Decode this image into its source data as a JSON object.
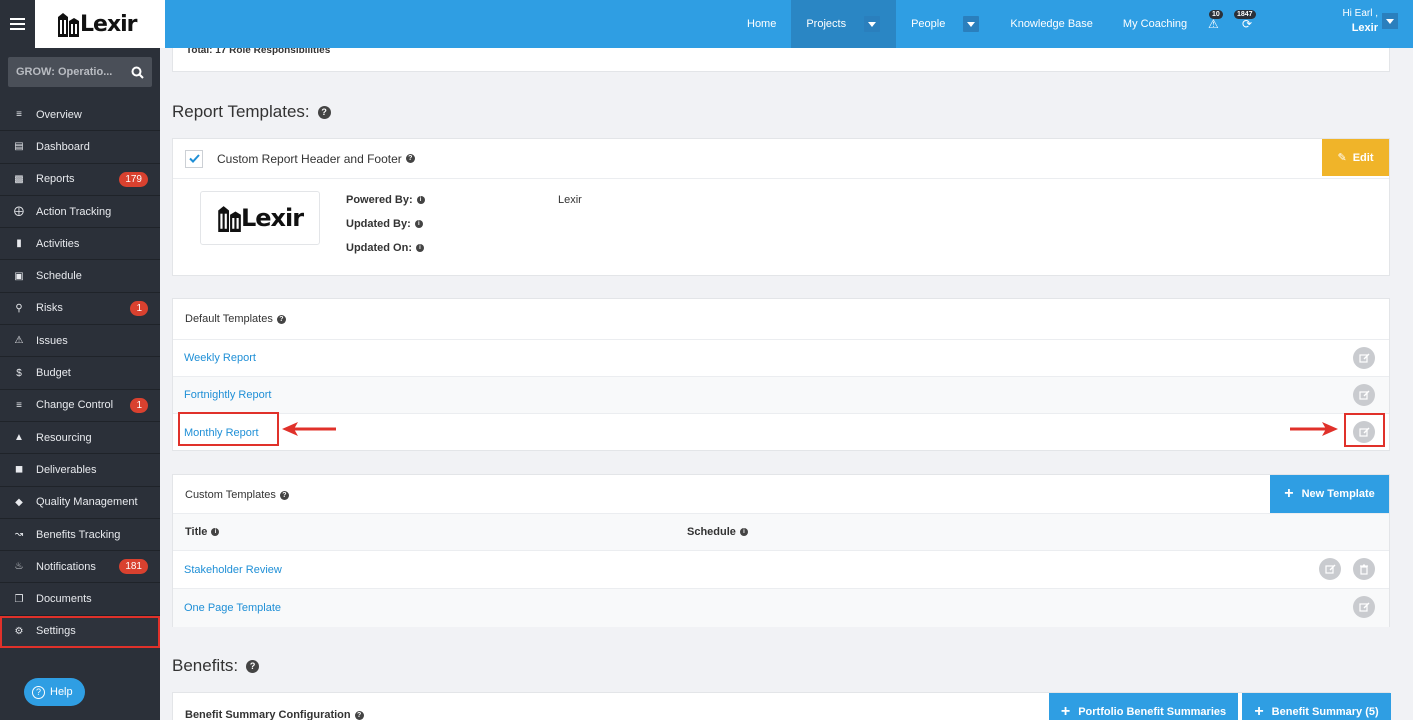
{
  "topbar": {
    "logo_text": "Lexir",
    "nav": [
      {
        "label": "Home"
      },
      {
        "label": "Projects"
      },
      {
        "label": "People"
      },
      {
        "label": "Knowledge Base"
      },
      {
        "label": "My Coaching"
      }
    ],
    "alerts_count": "10",
    "notifications_count": "1847",
    "greeting": "Hi Earl ,",
    "user_name": "Lexir"
  },
  "sidebar": {
    "search_value": "GROW: Operatio...",
    "items": [
      {
        "label": "Overview",
        "icon": "list-icon"
      },
      {
        "label": "Dashboard",
        "icon": "dashboard-icon"
      },
      {
        "label": "Reports",
        "icon": "bar-chart-icon",
        "badge": "179"
      },
      {
        "label": "Action Tracking",
        "icon": "crosshair-icon"
      },
      {
        "label": "Activities",
        "icon": "bookmark-icon"
      },
      {
        "label": "Schedule",
        "icon": "calendar-icon"
      },
      {
        "label": "Risks",
        "icon": "lightbulb-icon",
        "badge": "1"
      },
      {
        "label": "Issues",
        "icon": "warning-icon"
      },
      {
        "label": "Budget",
        "icon": "dollar-icon"
      },
      {
        "label": "Change Control",
        "icon": "stack-icon",
        "badge": "1"
      },
      {
        "label": "Resourcing",
        "icon": "folder-icon"
      },
      {
        "label": "Deliverables",
        "icon": "truck-icon"
      },
      {
        "label": "Quality Management",
        "icon": "tag-icon"
      },
      {
        "label": "Benefits Tracking",
        "icon": "line-chart-icon"
      },
      {
        "label": "Notifications",
        "icon": "bell-icon",
        "badge": "181"
      },
      {
        "label": "Documents",
        "icon": "copy-icon"
      },
      {
        "label": "Settings",
        "icon": "gears-icon"
      }
    ],
    "help_label": "Help"
  },
  "main": {
    "role_total": "Total: 17 Role Responsibilities",
    "report_templates_title": "Report Templates:",
    "header_footer": {
      "label": "Custom Report Header and Footer",
      "edit_label": "Edit",
      "logo_text": "Lexir",
      "powered_by_label": "Powered By:",
      "powered_by_value": "Lexir",
      "updated_by_label": "Updated By:",
      "updated_on_label": "Updated On:"
    },
    "default_templates": {
      "title": "Default Templates",
      "rows": [
        {
          "label": "Weekly Report"
        },
        {
          "label": "Fortnightly Report"
        },
        {
          "label": "Monthly Report"
        }
      ]
    },
    "custom_templates": {
      "title": "Custom Templates",
      "new_label": "New Template",
      "col_title": "Title",
      "col_schedule": "Schedule",
      "rows": [
        {
          "label": "Stakeholder Review"
        },
        {
          "label": "One Page Template"
        }
      ]
    },
    "benefits_title": "Benefits:",
    "benefit_summary": {
      "label": "Benefit Summary Configuration",
      "portfolio_btn": "Portfolio Benefit Summaries",
      "summary_btn": "Benefit Summary (5)"
    }
  },
  "colors": {
    "topbar": "#2f9ee3",
    "sidebar": "#2b3039",
    "accent_red": "#e0312a",
    "edit_yellow": "#f0b429"
  }
}
